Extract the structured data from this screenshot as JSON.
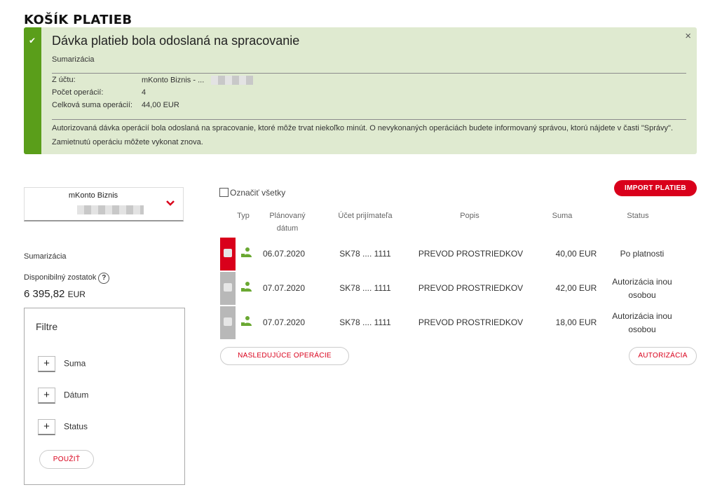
{
  "page_title": "KOŠÍK PLATIEB",
  "banner": {
    "title": "Dávka platieb bola odoslaná na spracovanie",
    "subtitle": "Sumarizácia",
    "close_icon": "×",
    "check_icon": "✔",
    "rows": [
      {
        "label": "Z účtu:",
        "value": "mKonto Biznis - ..."
      },
      {
        "label": "Počet operácií:",
        "value": "4"
      },
      {
        "label": "Celková suma operácií:",
        "value": "44,00 EUR"
      }
    ],
    "note": "Autorizovaná dávka operácií bola odoslaná na spracovanie, ktoré môže trvat niekoľko minút. O nevykonaných operáciách budete informovaný správou, ktorú nájdete v časti \"Správy\". Zamietnutú operáciu môžete vykonat znova."
  },
  "account": {
    "name": "mKonto Biznis",
    "chevron_icon": "chevron-down-icon"
  },
  "left": {
    "summary": "Sumarizácia",
    "available_label": "Disponibilný zostatok",
    "help_icon": "?",
    "balance": "6 395,82",
    "currency": "EUR"
  },
  "filters": {
    "title": "Filtre",
    "items": [
      "Suma",
      "Dátum",
      "Status"
    ],
    "apply": "POUŽIŤ"
  },
  "table": {
    "select_all": "Označiť všetky",
    "import_button": "IMPORT PLATIEB",
    "headers": {
      "type": "Typ",
      "date": "Plánovaný dátum",
      "account": "Účet prijímateľa",
      "desc": "Popis",
      "amount": "Suma",
      "status": "Status"
    },
    "rows": [
      {
        "date": "06.07.2020",
        "account": "SK78 .... 1111",
        "desc": "PREVOD PROSTRIEDKOV",
        "amount": "40,00 EUR",
        "status": "Po platnosti",
        "selector": "red"
      },
      {
        "date": "07.07.2020",
        "account": "SK78 .... 1111",
        "desc": "PREVOD PROSTRIEDKOV",
        "amount": "42,00 EUR",
        "status": "Autorizácia inou osobou",
        "selector": "grey"
      },
      {
        "date": "07.07.2020",
        "account": "SK78 .... 1111",
        "desc": "PREVOD PROSTRIEDKOV",
        "amount": "18,00 EUR",
        "status": "Autorizácia inou osobou",
        "selector": "grey"
      }
    ],
    "next_button": "NASLEDUJÚCE OPERÁCIE",
    "authorize_button": "AUTORIZÁCIA"
  },
  "colors": {
    "accent_red": "#d9001b",
    "success_green": "#5a9e1a",
    "banner_bg": "#dfead0",
    "type_icon_green": "#6aa832"
  }
}
